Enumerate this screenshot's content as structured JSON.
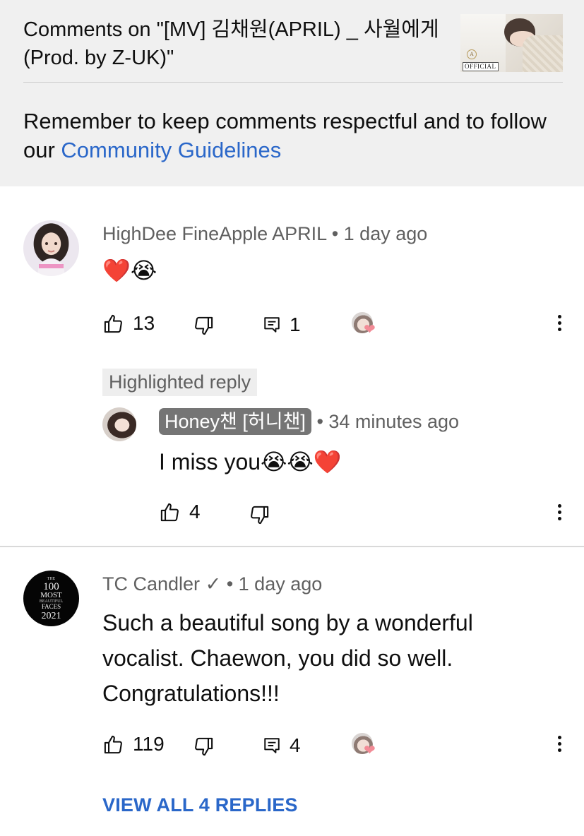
{
  "header": {
    "title": "Comments on \"[MV] 김채원(APRIL) _ 사월에게 (Prod. by Z-UK)\"",
    "thumbnail_label": "OFFICIAL",
    "notice_text": "Remember to keep comments respectful and to follow our ",
    "notice_link": "Community Guidelines"
  },
  "comments": [
    {
      "author": "HighDee FineApple APRIL",
      "time": "• 1 day ago",
      "text": "❤️😭",
      "likes": "13",
      "replies": "1"
    },
    {
      "author": "TC Candler",
      "verified_mark": "✓",
      "time": "• 1 day ago",
      "text": "Such a beautiful song by a wonderful vocalist.  Chaewon, you did so well. Congratulations!!!",
      "likes": "119",
      "replies": "4",
      "avatar_text": [
        "THE",
        "100",
        "MOST",
        "BEAUTIFUL",
        "FACES",
        "2021"
      ]
    }
  ],
  "highlighted_reply": {
    "chip": "Highlighted reply",
    "author": "Honey챈 [허니챈]",
    "time": "• 34 minutes ago",
    "text": "I miss you😭😭❤️",
    "likes": "4"
  },
  "view_all_replies": "VIEW ALL 4 REPLIES",
  "colors": {
    "header_bg": "#f0f0f0",
    "link": "#2a67c9",
    "secondary_text": "#606060",
    "badge_bg": "#757575"
  }
}
